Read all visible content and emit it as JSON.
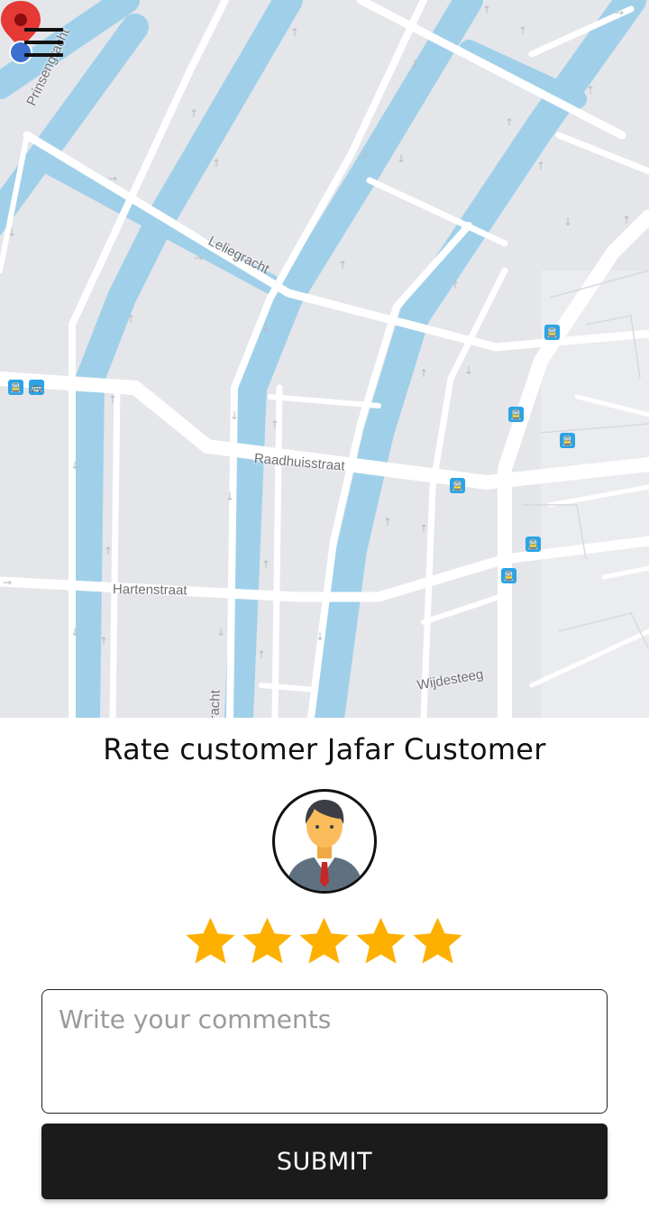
{
  "map": {
    "streets": [
      {
        "id": "prinsengracht",
        "label": "Prinsengracht"
      },
      {
        "id": "leliegracht",
        "label": "Leliegracht"
      },
      {
        "id": "raadhuisstraat",
        "label": "Raadhuisstraat"
      },
      {
        "id": "hartenstraat",
        "label": "Hartenstraat"
      },
      {
        "id": "wijdesteeg",
        "label": "Wijdesteeg"
      },
      {
        "id": "gracht-partial",
        "label": "racht"
      }
    ],
    "colors": {
      "land": "#e4e6ea",
      "water": "#a0d0e9",
      "road": "#ffffff",
      "transit": "#2ba3e6",
      "pin": "#e53935",
      "location_dot": "#3d6fd0"
    }
  },
  "menu": {
    "icon": "hamburger-menu-icon"
  },
  "rating": {
    "title": "Rate customer Jafar Customer",
    "avatar_icon": "customer-avatar-icon",
    "stars_total": 5,
    "stars_selected": 5,
    "star_color": "#fdb000"
  },
  "comment": {
    "placeholder": "Write your comments",
    "value": ""
  },
  "submit": {
    "label": "SUBMIT"
  }
}
